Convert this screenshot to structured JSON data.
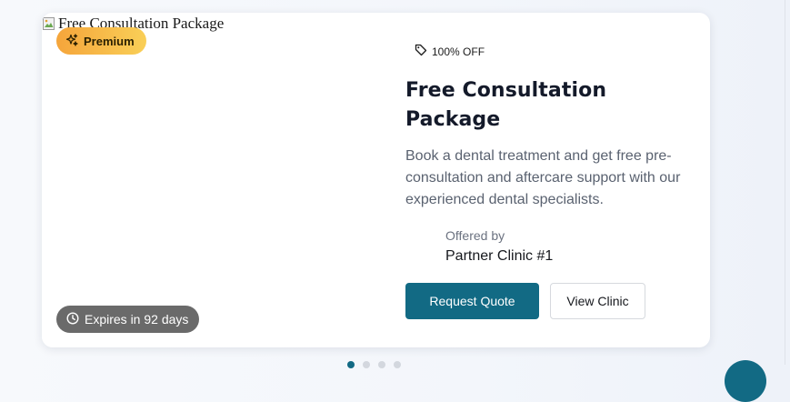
{
  "colors": {
    "primary": "#126a84",
    "premium_gradient_start": "#f5a53b",
    "premium_gradient_end": "#f9cf57",
    "expires_badge": "#6a6a6a"
  },
  "offer": {
    "image_alt": "Free Consultation Package",
    "premium_label": "Premium",
    "premium_icon": "sparkle-icon",
    "expires_label": "Expires in 92 days",
    "expires_icon": "clock-icon",
    "discount_label": "100% OFF",
    "discount_icon": "tag-icon",
    "title": "Free Consultation Package",
    "description": "Book a dental treatment and get free pre-consultation and aftercare support with our experienced dental specialists.",
    "offered_by_label": "Offered by",
    "clinic_name": "Partner Clinic #1",
    "request_quote_label": "Request Quote",
    "view_clinic_label": "View Clinic"
  },
  "carousel": {
    "slide_count": 4,
    "active_index": 0
  }
}
